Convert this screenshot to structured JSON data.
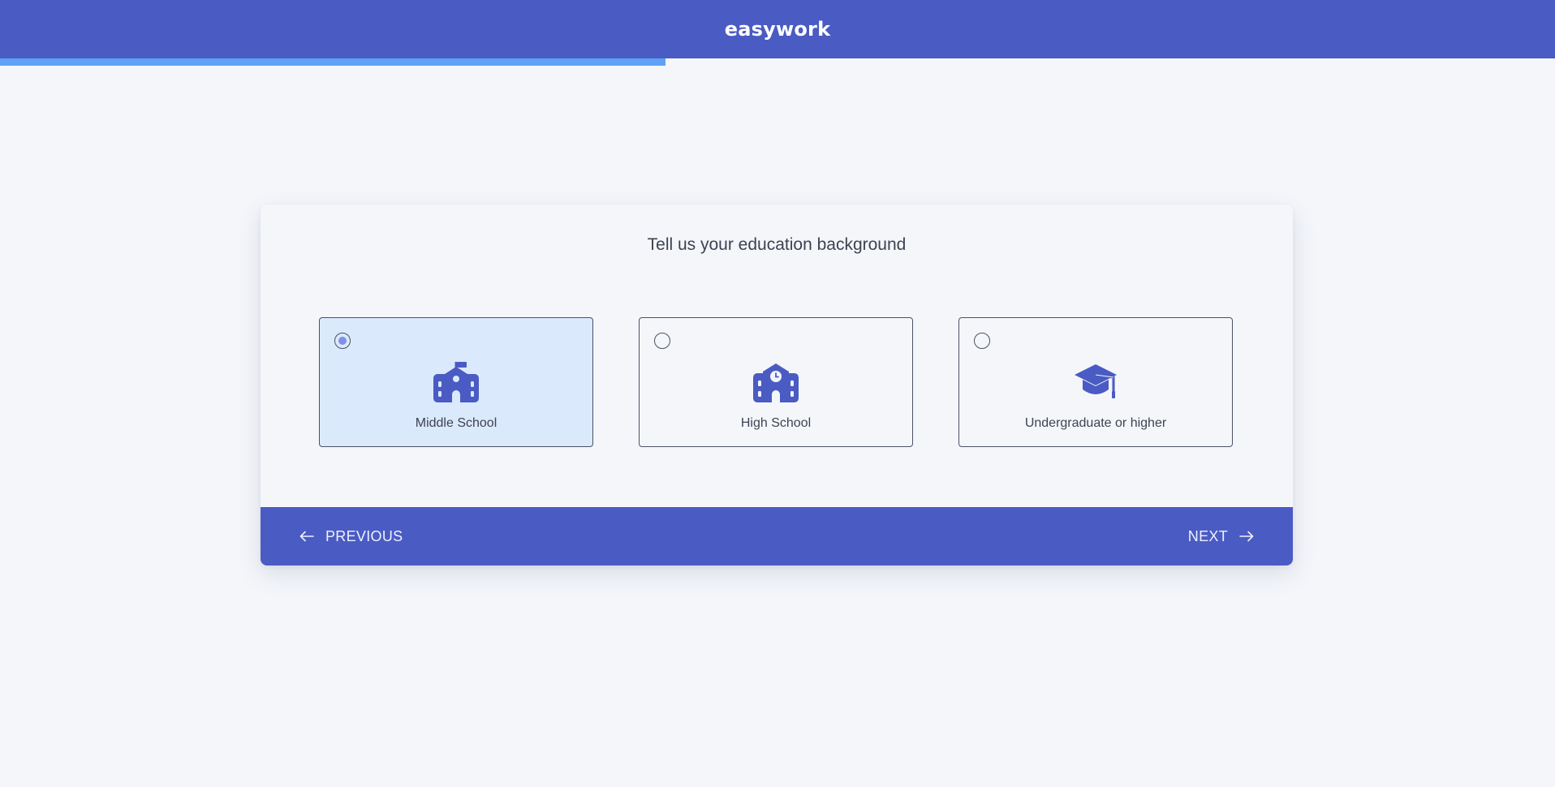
{
  "app": {
    "brand": "easywork"
  },
  "progress": {
    "fraction": 0.428
  },
  "step": {
    "question": "Tell us your education background",
    "options": [
      {
        "label": "Middle School",
        "icon": "middle-school-icon",
        "selected": true
      },
      {
        "label": "High School",
        "icon": "high-school-icon",
        "selected": false
      },
      {
        "label": "Undergraduate or higher",
        "icon": "graduation-cap-icon",
        "selected": false
      }
    ]
  },
  "nav": {
    "previous_label": "PREVIOUS",
    "previous_icon": "arrow-left-icon",
    "next_label": "NEXT",
    "next_icon": "arrow-right-icon"
  },
  "colors": {
    "primary": "#4a5bc3",
    "progress": "#5ea2f7",
    "selected_bg": "#dbe9fd",
    "background": "#f4f6fa"
  }
}
